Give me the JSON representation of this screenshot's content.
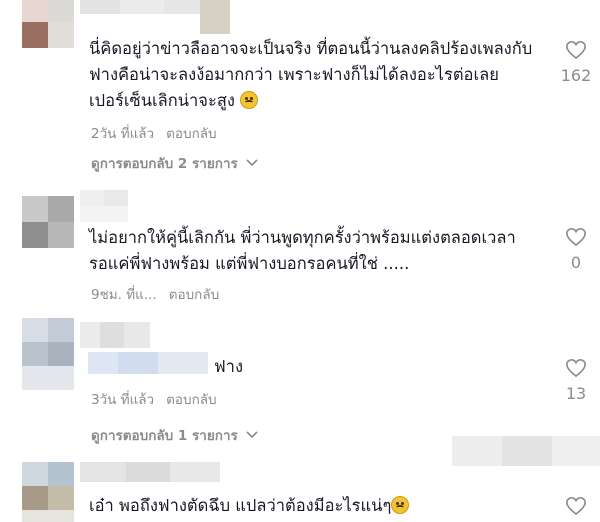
{
  "comments": [
    {
      "text": "นี่คิดอยู่ว่าข่าวลืออาจจะเป็นจริง ที่ตอนนี้ว่านลงคลิปร้องเพลงกับฟางคือน่าจะลงง้อมากกว่า เพราะฟางก็ไม่ได้ลงอะไรต่อเลย เปอร์เซ็นเลิกน่าจะสูง",
      "emoji": "sad-face-emoji",
      "time": "2วัน ที่แล้ว",
      "reply": "ตอบกลับ",
      "likes": "162",
      "view_replies": "ดูการตอบกลับ 2 รายการ"
    },
    {
      "text": "ไม่อยากให้คู่นี้เลิกกัน พี่ว่านพูดทุกครั้งว่าพร้อมแต่งตลอดเวลา รอแค่พี่ฟางพร้อม แต่พี่ฟางบอกรอคนที่ใช่ .....",
      "time": "9ชม. ที่แ...",
      "reply": "ตอบกลับ",
      "likes": "0"
    },
    {
      "text": "ฟาง",
      "time": "3วัน ที่แล้ว",
      "reply": "ตอบกลับ",
      "likes": "13",
      "view_replies": "ดูการตอบกลับ 1 รายการ"
    },
    {
      "text": "เอ๋า พอถึงฟางตัดฉึบ แปลว่าต้องมีอะไรแน่ๆ",
      "emoji": "thinking-face-emoji"
    }
  ]
}
